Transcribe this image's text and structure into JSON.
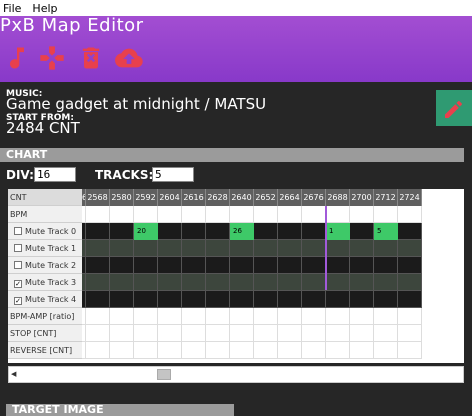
{
  "menu": [
    "File",
    "Help"
  ],
  "app_title": "PxB Map Editor",
  "toolbar": {
    "icons": [
      "music-note-icon",
      "gamepad-icon",
      "trash-icon",
      "cloud-upload-icon"
    ]
  },
  "colors": {
    "accent": "#9544cf",
    "tool_icon": "#e8404d",
    "note": "#3ec968",
    "edit_button": "#2f9a72"
  },
  "info": {
    "music_label": "MUSIC:",
    "music_value": "Game gadget at midnight / MATSU",
    "start_label": "START FROM:",
    "start_value": "2484 CNT"
  },
  "sections": {
    "chart": "CHART",
    "target_image": "TARGET IMAGE"
  },
  "controls": {
    "div_label": "DIV:",
    "div_value": "16",
    "tracks_label": "TRACKS:",
    "tracks_value": "5"
  },
  "grid": {
    "partial_header": "6",
    "columns": [
      "2568",
      "2580",
      "2592",
      "2604",
      "2616",
      "2628",
      "2640",
      "2652",
      "2664",
      "2676",
      "2688",
      "2700",
      "2712",
      "2724"
    ],
    "rows": [
      {
        "label": "CNT",
        "checkbox": false,
        "checked": false
      },
      {
        "label": "BPM",
        "checkbox": false,
        "checked": false
      },
      {
        "label": "Mute Track 0",
        "checkbox": true,
        "checked": false
      },
      {
        "label": "Mute Track 1",
        "checkbox": true,
        "checked": false
      },
      {
        "label": "Mute Track 2",
        "checkbox": true,
        "checked": false
      },
      {
        "label": "Mute Track 3",
        "checkbox": true,
        "checked": true
      },
      {
        "label": "Mute Track 4",
        "checkbox": true,
        "checked": true
      },
      {
        "label": "BPM-AMP [ratio]",
        "checkbox": false,
        "checked": false
      },
      {
        "label": "STOP [CNT]",
        "checkbox": false,
        "checked": false
      },
      {
        "label": "REVERSE [CNT]",
        "checkbox": false,
        "checked": false
      }
    ],
    "notes": [
      {
        "column": "2592",
        "track": 0,
        "label": "20"
      },
      {
        "column": "2640",
        "track": 0,
        "label": "26"
      },
      {
        "column": "2688",
        "track": 0,
        "label": "1"
      },
      {
        "column": "2712",
        "track": 0,
        "label": "5"
      }
    ],
    "scroll_left_arrow": "◀"
  }
}
